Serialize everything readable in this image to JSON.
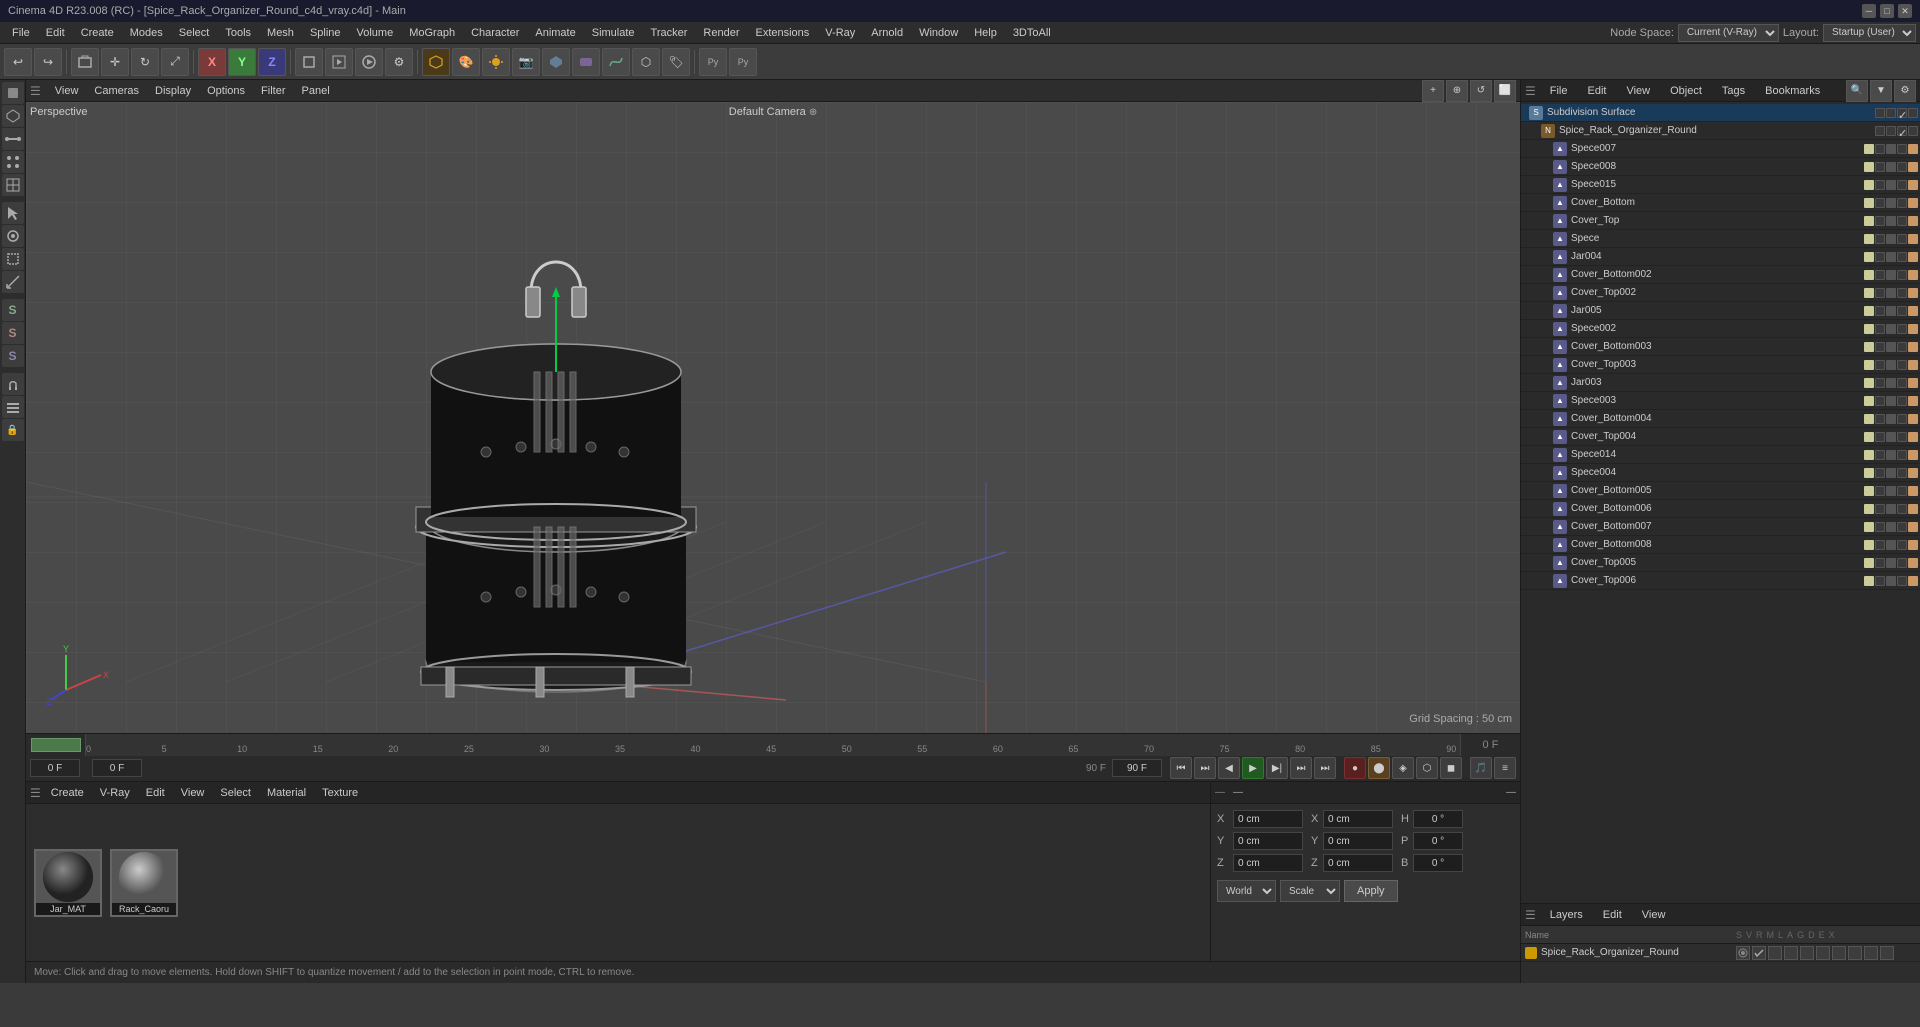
{
  "app": {
    "title": "Cinema 4D R23.008 (RC) - [Spice_Rack_Organizer_Round_c4d_vray.c4d] - Main",
    "node_space_label": "Node Space:",
    "node_space_value": "Current (V-Ray)",
    "layout_label": "Layout:",
    "layout_value": "Startup (User)"
  },
  "menu": {
    "items": [
      "File",
      "Edit",
      "Create",
      "Modes",
      "Select",
      "Tools",
      "Mesh",
      "Spline",
      "Volume",
      "MoGraph",
      "Character",
      "Animate",
      "Simulate",
      "Tracker",
      "Render",
      "Extensions",
      "V-Ray",
      "Arnold",
      "Window",
      "Help",
      "3DToAll"
    ]
  },
  "viewport": {
    "label": "Perspective",
    "camera": "Default Camera",
    "grid_info": "Grid Spacing : 50 cm",
    "menus": [
      "View",
      "Cameras",
      "Display",
      "Options",
      "Filter",
      "Panel"
    ]
  },
  "timeline": {
    "frame_start": "0 F",
    "frame_end": "90 F",
    "current_frame": "0 F",
    "current_time": "0 F",
    "end_time": "90 F",
    "end_frame": "90 F",
    "ticks": [
      "0",
      "5",
      "10",
      "15",
      "20",
      "25",
      "30",
      "35",
      "40",
      "45",
      "50",
      "55",
      "60",
      "65",
      "70",
      "75",
      "80",
      "85",
      "90"
    ]
  },
  "materials": {
    "header_menus": [
      "Create",
      "V-Ray",
      "Edit",
      "View",
      "Select",
      "Material",
      "Texture"
    ],
    "items": [
      {
        "name": "Jar_MAT"
      },
      {
        "name": "Rack_Caoru"
      }
    ]
  },
  "coords": {
    "x_pos": "0 cm",
    "y_pos": "0 cm",
    "z_pos": "0 cm",
    "x_rot": "0 cm",
    "y_rot": "0 cm",
    "z_rot": "0 cm",
    "h_val": "0 °",
    "p_val": "0 °",
    "b_val": "0 °",
    "transform_space": "World",
    "transform_mode": "Scale",
    "apply_btn": "Apply"
  },
  "status": {
    "message": "Move: Click and drag to move elements. Hold down SHIFT to quantize movement / add to the selection in point mode, CTRL to remove."
  },
  "object_manager": {
    "title": "Subdivision Surface",
    "header_menus": [
      "File",
      "Edit",
      "View",
      "Object",
      "Tags",
      "Bookmarks"
    ],
    "objects": [
      {
        "name": "Subdivision Surface",
        "type": "null",
        "indent": 0,
        "active": true
      },
      {
        "name": "Spice_Rack_Organizer_Round",
        "type": "null",
        "indent": 1
      },
      {
        "name": "Spece007",
        "type": "poly",
        "indent": 2
      },
      {
        "name": "Spece008",
        "type": "poly",
        "indent": 2
      },
      {
        "name": "Spece015",
        "type": "poly",
        "indent": 2
      },
      {
        "name": "Cover_Bottom",
        "type": "poly",
        "indent": 2
      },
      {
        "name": "Cover_Top",
        "type": "poly",
        "indent": 2
      },
      {
        "name": "Spece",
        "type": "poly",
        "indent": 2
      },
      {
        "name": "Jar004",
        "type": "poly",
        "indent": 2
      },
      {
        "name": "Cover_Bottom002",
        "type": "poly",
        "indent": 2
      },
      {
        "name": "Cover_Top002",
        "type": "poly",
        "indent": 2
      },
      {
        "name": "Jar005",
        "type": "poly",
        "indent": 2
      },
      {
        "name": "Spece002",
        "type": "poly",
        "indent": 2
      },
      {
        "name": "Cover_Bottom003",
        "type": "poly",
        "indent": 2
      },
      {
        "name": "Cover_Top003",
        "type": "poly",
        "indent": 2
      },
      {
        "name": "Jar003",
        "type": "poly",
        "indent": 2
      },
      {
        "name": "Spece003",
        "type": "poly",
        "indent": 2
      },
      {
        "name": "Cover_Bottom004",
        "type": "poly",
        "indent": 2
      },
      {
        "name": "Cover_Top004",
        "type": "poly",
        "indent": 2
      },
      {
        "name": "Spece014",
        "type": "poly",
        "indent": 2
      },
      {
        "name": "Spece004",
        "type": "poly",
        "indent": 2
      },
      {
        "name": "Cover_Bottom005",
        "type": "poly",
        "indent": 2
      },
      {
        "name": "Cover_Bottom006",
        "type": "poly",
        "indent": 2
      },
      {
        "name": "Cover_Bottom007",
        "type": "poly",
        "indent": 2
      },
      {
        "name": "Cover_Bottom008",
        "type": "poly",
        "indent": 2
      },
      {
        "name": "Cover_Top005",
        "type": "poly",
        "indent": 2
      },
      {
        "name": "Cover_Top006",
        "type": "poly",
        "indent": 2
      }
    ]
  },
  "layers": {
    "header_menus": [
      "Layers",
      "Edit",
      "View"
    ],
    "columns_label": "Name",
    "items": [
      {
        "name": "Spice_Rack_Organizer_Round",
        "color": "#cc9900"
      }
    ]
  },
  "icons": {
    "undo": "↩",
    "redo": "↪",
    "move": "✛",
    "rotate": "↻",
    "scale": "⤢",
    "select_rect": "▭",
    "select_live": "◎",
    "select_poly": "⬡",
    "x_axis": "X",
    "y_axis": "Y",
    "z_axis": "Z",
    "render": "▶",
    "play": "▶",
    "stop": "■",
    "prev": "◀",
    "next": "▶",
    "first": "⏮",
    "last": "⏭"
  }
}
